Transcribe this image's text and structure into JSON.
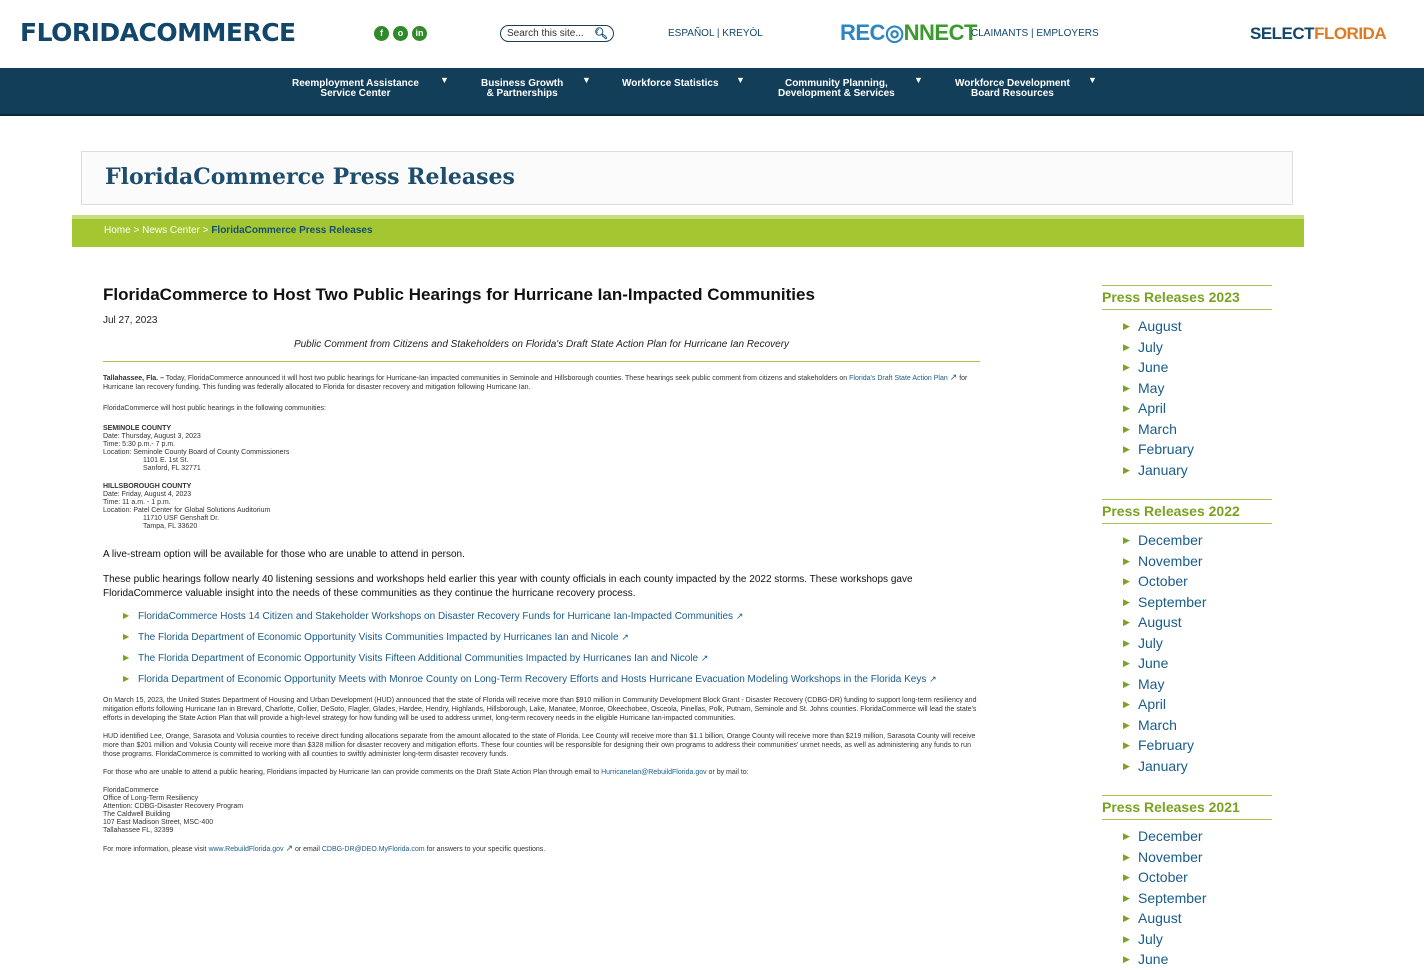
{
  "header": {
    "logo": "FLORIDACOMMERCE",
    "social": [
      "f",
      "o",
      "in"
    ],
    "search_placeholder": "Search this site...",
    "lang": "ESPAÑOL | KREYÒL",
    "reconnect_a": "REC",
    "reconnect_b": "NNECT",
    "reconnect_links": "CLAIMANTS | EMPLOYERS",
    "selectflorida_a": "SELECT",
    "selectflorida_b": "FLORIDA"
  },
  "nav": [
    {
      "l1": "Reemployment Assistance",
      "l2": "Service Center"
    },
    {
      "l1": "Business Growth",
      "l2": "& Partnerships"
    },
    {
      "l1": "Workforce Statistics",
      "l2": ""
    },
    {
      "l1": "Community Planning,",
      "l2": "Development & Services"
    },
    {
      "l1": "Workforce Development",
      "l2": "Board Resources"
    }
  ],
  "page_title": "FloridaCommerce Press Releases",
  "breadcrumb": {
    "home": "Home",
    "sep": ">",
    "news": "News Center",
    "current": "FloridaCommerce Press Releases"
  },
  "article": {
    "title": "FloridaCommerce to Host Two Public Hearings for Hurricane Ian-Impacted Communities",
    "date": "Jul 27, 2023",
    "subtitle": "Public Comment from Citizens and Stakeholders on Florida's Draft State Action Plan for Hurricane Ian Recovery",
    "intro_bold": "Tallahassee, Fla. –",
    "intro_1": " Today, FloridaCommerce announced it will host two public hearings for Hurricane-Ian impacted communities in Seminole and Hillsborough counties. These hearings seek public comment from citizens and stakeholders on ",
    "intro_link": "Florida's Draft State Action Plan",
    "intro_2": " for Hurricane Ian recovery funding. This funding was federally allocated to Florida for disaster recovery and mitigation following Hurricane Ian.",
    "host_line": "FloridaCommerce will host public hearings in the following communities:",
    "seminole": {
      "name": "SEMINOLE COUNTY",
      "date": "Date: Thursday, August 3, 2023",
      "time": "Time: 5:30 p.m.- 7 p.m.",
      "location": "Location: Seminole County Board of County Commissioners",
      "addr1": "1101 E. 1st St.",
      "addr2": "Sanford, FL 32771"
    },
    "hillsborough": {
      "name": "HILLSBOROUGH COUNTY",
      "date": "Date: Friday, August 4, 2023",
      "time": "Time: 11 a.m. - 1 p.m.",
      "location": "Location: Patel Center for Global Solutions Auditorium",
      "addr1": "11710 USF Genshaft Dr.",
      "addr2": "Tampa, FL 33620"
    },
    "livestream": "A live-stream option will be available for those who are unable to attend in person.",
    "follow": "These public hearings follow nearly 40 listening sessions and workshops held earlier this year with county officials in each county impacted by the 2022 storms. These workshops gave FloridaCommerce valuable insight into the needs of these communities as they continue the hurricane recovery process.",
    "related_links": [
      "FloridaCommerce Hosts 14 Citizen and Stakeholder Workshops on Disaster Recovery Funds for Hurricane Ian-Impacted Communities",
      "The Florida Department of Economic Opportunity Visits Communities Impacted by Hurricanes Ian and Nicole",
      "The Florida Department of Economic Opportunity Visits Fifteen Additional Communities Impacted by Hurricanes Ian and Nicole",
      "Florida Department of Economic Opportunity Meets with Monroe County on Long-Term Recovery Efforts and Hosts Hurricane Evacuation Modeling Workshops in the Florida Keys"
    ],
    "hud_para": "On March 15, 2023, the United States Department of Housing and Urban Development (HUD) announced that the state of Florida will receive more than $910 million in Community Development Block Grant - Disaster Recovery (CDBG-DR) funding to support long-term resiliency and mitigation efforts following Hurricane Ian in Brevard, Charlotte, Collier, DeSoto, Flagler, Glades, Hardee, Hendry, Highlands, Hillsborough, Lake, Manatee, Monroe, Okeechobee, Osceola, Pinellas, Polk, Putnam, Seminole and St. Johns counties. FloridaCommerce will lead the state's efforts in developing the State Action Plan that will provide a high-level strategy for how funding will be used to address unmet, long-term recovery needs in the eligible Hurricane Ian-impacted communities.",
    "hud_direct": "HUD identified Lee, Orange, Sarasota and Volusia counties to receive direct funding allocations separate from the amount allocated to the state of Florida. Lee County will receive more than $1.1 billion, Orange County will receive more than $219 million, Sarasota County will receive more than $201 million and Volusia County will receive more than $328 million for disaster recovery and mitigation efforts. These four counties will be responsible for designing their own programs to address their communities' unmet needs, as well as administering any funds to run those programs. FloridaCommerce is committed to working with all counties to swiftly administer long-term disaster recovery funds.",
    "comment_1": "For those who are unable to attend a public hearing, Floridians impacted by Hurricane Ian can provide comments on the Draft State Action Plan through email to ",
    "comment_email": "HurricaneIan@RebuildFlorida.gov",
    "comment_2": " or by mail to:",
    "mail": [
      "FloridaCommerce",
      "Office of Long-Term Resiliency",
      "Attention: CDBG-Disaster Recovery Program",
      "The Caldwell Building",
      "107 East Madison Street, MSC-400",
      "Tallahassee FL, 32399"
    ],
    "more_1": "For more information, please visit ",
    "more_link": "www.RebuildFlorida.gov",
    "more_2": " or email ",
    "more_email": "CDBG-DR@DEO.MyFlorida.com",
    "more_3": " for answers to your specific questions."
  },
  "sidebar": [
    {
      "title": "Press Releases 2023",
      "months": [
        "August",
        "July",
        "June",
        "May",
        "April",
        "March",
        "February",
        "January"
      ]
    },
    {
      "title": "Press Releases 2022",
      "months": [
        "December",
        "November",
        "October",
        "September",
        "August",
        "July",
        "June",
        "May",
        "April",
        "March",
        "February",
        "January"
      ]
    },
    {
      "title": "Press Releases 2021",
      "months": [
        "December",
        "November",
        "October",
        "September",
        "August",
        "July",
        "June"
      ]
    }
  ],
  "colors": {
    "navy": "#123e5a",
    "green": "#a3c631",
    "link": "#1a5c8a"
  }
}
